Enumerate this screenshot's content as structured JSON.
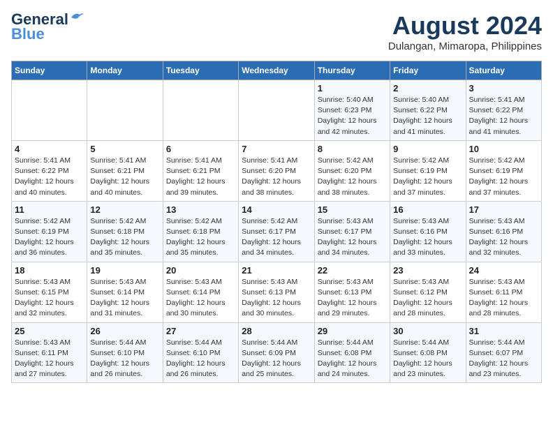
{
  "header": {
    "logo_line1": "General",
    "logo_line2": "Blue",
    "title": "August 2024",
    "subtitle": "Dulangan, Mimaropa, Philippines"
  },
  "days_of_week": [
    "Sunday",
    "Monday",
    "Tuesday",
    "Wednesday",
    "Thursday",
    "Friday",
    "Saturday"
  ],
  "weeks": [
    [
      {
        "day": "",
        "info": ""
      },
      {
        "day": "",
        "info": ""
      },
      {
        "day": "",
        "info": ""
      },
      {
        "day": "",
        "info": ""
      },
      {
        "day": "1",
        "info": "Sunrise: 5:40 AM\nSunset: 6:23 PM\nDaylight: 12 hours\nand 42 minutes."
      },
      {
        "day": "2",
        "info": "Sunrise: 5:40 AM\nSunset: 6:22 PM\nDaylight: 12 hours\nand 41 minutes."
      },
      {
        "day": "3",
        "info": "Sunrise: 5:41 AM\nSunset: 6:22 PM\nDaylight: 12 hours\nand 41 minutes."
      }
    ],
    [
      {
        "day": "4",
        "info": "Sunrise: 5:41 AM\nSunset: 6:22 PM\nDaylight: 12 hours\nand 40 minutes."
      },
      {
        "day": "5",
        "info": "Sunrise: 5:41 AM\nSunset: 6:21 PM\nDaylight: 12 hours\nand 40 minutes."
      },
      {
        "day": "6",
        "info": "Sunrise: 5:41 AM\nSunset: 6:21 PM\nDaylight: 12 hours\nand 39 minutes."
      },
      {
        "day": "7",
        "info": "Sunrise: 5:41 AM\nSunset: 6:20 PM\nDaylight: 12 hours\nand 38 minutes."
      },
      {
        "day": "8",
        "info": "Sunrise: 5:42 AM\nSunset: 6:20 PM\nDaylight: 12 hours\nand 38 minutes."
      },
      {
        "day": "9",
        "info": "Sunrise: 5:42 AM\nSunset: 6:19 PM\nDaylight: 12 hours\nand 37 minutes."
      },
      {
        "day": "10",
        "info": "Sunrise: 5:42 AM\nSunset: 6:19 PM\nDaylight: 12 hours\nand 37 minutes."
      }
    ],
    [
      {
        "day": "11",
        "info": "Sunrise: 5:42 AM\nSunset: 6:19 PM\nDaylight: 12 hours\nand 36 minutes."
      },
      {
        "day": "12",
        "info": "Sunrise: 5:42 AM\nSunset: 6:18 PM\nDaylight: 12 hours\nand 35 minutes."
      },
      {
        "day": "13",
        "info": "Sunrise: 5:42 AM\nSunset: 6:18 PM\nDaylight: 12 hours\nand 35 minutes."
      },
      {
        "day": "14",
        "info": "Sunrise: 5:42 AM\nSunset: 6:17 PM\nDaylight: 12 hours\nand 34 minutes."
      },
      {
        "day": "15",
        "info": "Sunrise: 5:43 AM\nSunset: 6:17 PM\nDaylight: 12 hours\nand 34 minutes."
      },
      {
        "day": "16",
        "info": "Sunrise: 5:43 AM\nSunset: 6:16 PM\nDaylight: 12 hours\nand 33 minutes."
      },
      {
        "day": "17",
        "info": "Sunrise: 5:43 AM\nSunset: 6:16 PM\nDaylight: 12 hours\nand 32 minutes."
      }
    ],
    [
      {
        "day": "18",
        "info": "Sunrise: 5:43 AM\nSunset: 6:15 PM\nDaylight: 12 hours\nand 32 minutes."
      },
      {
        "day": "19",
        "info": "Sunrise: 5:43 AM\nSunset: 6:14 PM\nDaylight: 12 hours\nand 31 minutes."
      },
      {
        "day": "20",
        "info": "Sunrise: 5:43 AM\nSunset: 6:14 PM\nDaylight: 12 hours\nand 30 minutes."
      },
      {
        "day": "21",
        "info": "Sunrise: 5:43 AM\nSunset: 6:13 PM\nDaylight: 12 hours\nand 30 minutes."
      },
      {
        "day": "22",
        "info": "Sunrise: 5:43 AM\nSunset: 6:13 PM\nDaylight: 12 hours\nand 29 minutes."
      },
      {
        "day": "23",
        "info": "Sunrise: 5:43 AM\nSunset: 6:12 PM\nDaylight: 12 hours\nand 28 minutes."
      },
      {
        "day": "24",
        "info": "Sunrise: 5:43 AM\nSunset: 6:11 PM\nDaylight: 12 hours\nand 28 minutes."
      }
    ],
    [
      {
        "day": "25",
        "info": "Sunrise: 5:43 AM\nSunset: 6:11 PM\nDaylight: 12 hours\nand 27 minutes."
      },
      {
        "day": "26",
        "info": "Sunrise: 5:44 AM\nSunset: 6:10 PM\nDaylight: 12 hours\nand 26 minutes."
      },
      {
        "day": "27",
        "info": "Sunrise: 5:44 AM\nSunset: 6:10 PM\nDaylight: 12 hours\nand 26 minutes."
      },
      {
        "day": "28",
        "info": "Sunrise: 5:44 AM\nSunset: 6:09 PM\nDaylight: 12 hours\nand 25 minutes."
      },
      {
        "day": "29",
        "info": "Sunrise: 5:44 AM\nSunset: 6:08 PM\nDaylight: 12 hours\nand 24 minutes."
      },
      {
        "day": "30",
        "info": "Sunrise: 5:44 AM\nSunset: 6:08 PM\nDaylight: 12 hours\nand 23 minutes."
      },
      {
        "day": "31",
        "info": "Sunrise: 5:44 AM\nSunset: 6:07 PM\nDaylight: 12 hours\nand 23 minutes."
      }
    ]
  ]
}
